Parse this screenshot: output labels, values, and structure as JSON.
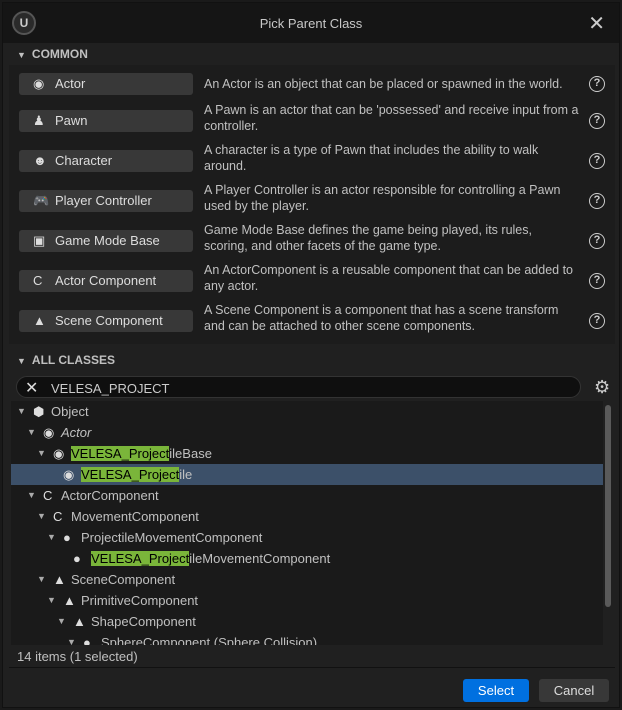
{
  "window": {
    "title": "Pick Parent Class",
    "logo": "U"
  },
  "common": {
    "header": "COMMON",
    "items": [
      {
        "label": "Actor",
        "icon": "actor-icon",
        "glyph": "◉",
        "desc": "An Actor is an object that can be placed or spawned in the world."
      },
      {
        "label": "Pawn",
        "icon": "pawn-icon",
        "glyph": "♟",
        "desc": "A Pawn is an actor that can be 'possessed' and receive input from a controller."
      },
      {
        "label": "Character",
        "icon": "character-icon",
        "glyph": "☻",
        "desc": "A character is a type of Pawn that includes the ability to walk around."
      },
      {
        "label": "Player Controller",
        "icon": "gamepad-icon",
        "glyph": "🎮",
        "desc": "A Player Controller is an actor responsible for controlling a Pawn used by the player."
      },
      {
        "label": "Game Mode Base",
        "icon": "image-icon",
        "glyph": "▣",
        "desc": "Game Mode Base defines the game being played, its rules, scoring, and other facets of the game type."
      },
      {
        "label": "Actor Component",
        "icon": "component-icon",
        "glyph": "C",
        "desc": "An ActorComponent is a reusable component that can be added to any actor."
      },
      {
        "label": "Scene Component",
        "icon": "scene-component-icon",
        "glyph": "▲",
        "desc": "A Scene Component is a component that has a scene transform and can be attached to other scene components."
      }
    ],
    "help": "?"
  },
  "all_classes": {
    "header": "ALL CLASSES",
    "search_value": "VELESA_PROJECT",
    "tree": [
      {
        "match": "",
        "rest": "Object",
        "level": 0,
        "arrow": true,
        "icon": "object-icon",
        "glyph": "⬢"
      },
      {
        "match": "",
        "rest": "Actor",
        "level": 1,
        "arrow": true,
        "icon": "actor-icon",
        "glyph": "◉",
        "italic": true
      },
      {
        "match": "VELESA_Project",
        "rest": "ileBase",
        "level": 2,
        "arrow": true,
        "icon": "actor-icon",
        "glyph": "◉"
      },
      {
        "match": "VELESA_Project",
        "rest": "ile",
        "level": 3,
        "arrow": false,
        "icon": "actor-icon",
        "glyph": "◉",
        "selected": true
      },
      {
        "match": "",
        "rest": "ActorComponent",
        "level": 1,
        "arrow": true,
        "icon": "component-icon",
        "glyph": "C"
      },
      {
        "match": "",
        "rest": "MovementComponent",
        "level": 2,
        "arrow": true,
        "icon": "component-icon",
        "glyph": "C"
      },
      {
        "match": "",
        "rest": "ProjectileMovementComponent",
        "level": 3,
        "arrow": true,
        "icon": "projectile-icon",
        "glyph": "●"
      },
      {
        "match": "VELESA_Project",
        "rest": "ileMovementComponent",
        "level": 4,
        "arrow": false,
        "icon": "projectile-icon",
        "glyph": "●"
      },
      {
        "match": "",
        "rest": "SceneComponent",
        "level": 2,
        "arrow": true,
        "icon": "scene-component-icon",
        "glyph": "▲"
      },
      {
        "match": "",
        "rest": "PrimitiveComponent",
        "level": 3,
        "arrow": true,
        "icon": "scene-component-icon",
        "glyph": "▲"
      },
      {
        "match": "",
        "rest": "ShapeComponent",
        "level": 4,
        "arrow": true,
        "icon": "scene-component-icon",
        "glyph": "▲"
      },
      {
        "match": "",
        "rest": "SphereComponent (Sphere Collision)",
        "level": 5,
        "arrow": true,
        "icon": "sphere-icon",
        "glyph": "●"
      }
    ],
    "status": "14 items (1 selected)"
  },
  "footer": {
    "select": "Select",
    "cancel": "Cancel"
  },
  "colors": {
    "accent": "#0070e0",
    "highlight": "#7ab53a",
    "selected_row": "#3c5069"
  }
}
